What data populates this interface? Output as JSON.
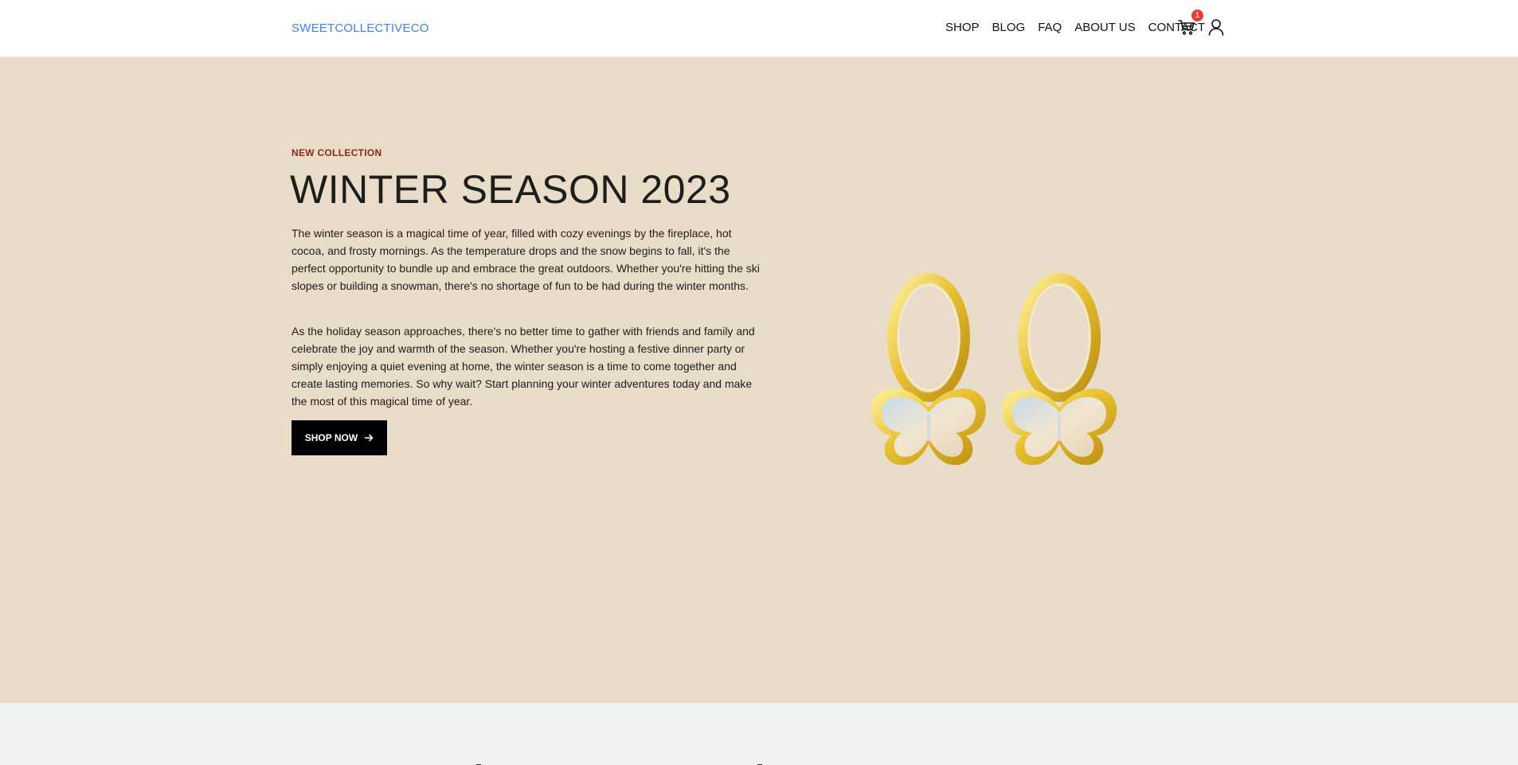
{
  "header": {
    "brand": "SWEETCOLLECTIVECO",
    "nav": [
      "SHOP",
      "BLOG",
      "FAQ",
      "ABOUT US",
      "CONTACT"
    ],
    "cart_count": "1",
    "icons": [
      "cart-icon",
      "user-icon"
    ]
  },
  "hero": {
    "eyebrow": "NEW COLLECTION",
    "title": "WINTER SEASON 2023",
    "paragraph1": "The winter season is a magical time of year, filled with cozy evenings by the fireplace, hot cocoa, and frosty mornings. As the temperature drops and the snow begins to fall, it's the perfect opportunity to bundle up and embrace the great outdoors. Whether you're hitting the ski slopes or building a snowman, there's no shortage of fun to be had during the winter months.",
    "paragraph2": "As the holiday season approaches, there's no better time to gather with friends and family and celebrate the joy and warmth of the season. Whether you're hosting a festive dinner party or simply enjoying a quiet evening at home, the winter season is a time to come together and create lasting memories. So why wait? Start planning your winter adventures today and make the most of this magical time of year.",
    "cta_label": "SHOP NOW",
    "cta_icon": "arrow-right-icon"
  },
  "colors": {
    "brand": "#3b82f6",
    "hero_bg": "#e9dcc9",
    "eyebrow": "#8b2a14",
    "badge": "#e53e3e",
    "button_bg": "#000000"
  }
}
